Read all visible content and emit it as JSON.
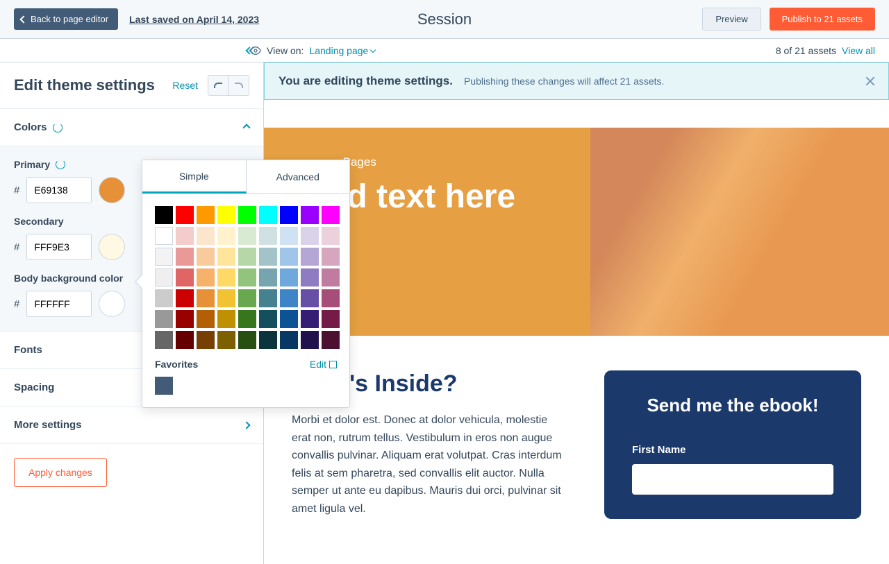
{
  "topbar": {
    "back": "Back to page editor",
    "last_saved": "Last saved on April 14, 2023",
    "title": "Session",
    "preview": "Preview",
    "publish": "Publish to 21 assets"
  },
  "subbar": {
    "view_on_label": "View on:",
    "view_on_value": "Landing page",
    "assets": "8 of 21 assets",
    "view_all": "View all"
  },
  "sidebar": {
    "title": "Edit theme settings",
    "reset": "Reset",
    "apply": "Apply changes",
    "sections": {
      "colors": "Colors",
      "fonts": "Fonts",
      "spacing": "Spacing",
      "more": "More settings"
    },
    "colors": {
      "primary": {
        "label": "Primary",
        "value": "E69138",
        "swatch": "#E69138"
      },
      "secondary": {
        "label": "Secondary",
        "value": "FFF9E3",
        "swatch": "#FFF9E3"
      },
      "body_bg": {
        "label": "Body background color",
        "value": "FFFFFF",
        "swatch": "#FFFFFF"
      }
    }
  },
  "notice": {
    "bold": "You are editing theme settings.",
    "text": "Publishing these changes will affect 21 assets."
  },
  "picker": {
    "tabs": {
      "simple": "Simple",
      "advanced": "Advanced"
    },
    "favorites_label": "Favorites",
    "edit": "Edit",
    "favorite_color": "#425b76",
    "grid": [
      [
        "#000000",
        "#ff0000",
        "#ff9900",
        "#ffff00",
        "#00ff00",
        "#00ffff",
        "#0000ff",
        "#9900ff",
        "#ff00ff"
      ],
      [
        "#ffffff",
        "#f4cccc",
        "#fce5cd",
        "#fff2cc",
        "#d9ead3",
        "#d0e0e3",
        "#cfe2f3",
        "#d9d2e9",
        "#ead1dc"
      ],
      [
        "#f3f3f3",
        "#ea9999",
        "#f9cb9c",
        "#ffe599",
        "#b6d7a8",
        "#a2c4c9",
        "#9fc5e8",
        "#b4a7d6",
        "#d5a6bd"
      ],
      [
        "#efefef",
        "#e06666",
        "#f6b26b",
        "#ffd966",
        "#93c47d",
        "#76a5af",
        "#6fa8dc",
        "#8e7cc3",
        "#c27ba0"
      ],
      [
        "#cccccc",
        "#cc0000",
        "#e69138",
        "#f1c232",
        "#6aa84f",
        "#45818e",
        "#3d85c6",
        "#674ea7",
        "#a64d79"
      ],
      [
        "#999999",
        "#990000",
        "#b45f06",
        "#bf9000",
        "#38761d",
        "#134f5c",
        "#0b5394",
        "#351c75",
        "#741b47"
      ],
      [
        "#666666",
        "#660000",
        "#783f04",
        "#7f6000",
        "#274e13",
        "#0c343d",
        "#073763",
        "#20124d",
        "#4c1130"
      ]
    ]
  },
  "preview": {
    "hero_label": "ng Pages",
    "hero_title": "dd text here",
    "body_title": "What's Inside?",
    "body_text": "Morbi et dolor est. Donec at dolor vehicula, molestie erat non, rutrum tellus. Vestibulum in eros non augue convallis pulvinar. Aliquam erat volutpat. Cras interdum felis at sem pharetra, sed convallis elit auctor. Nulla semper ut ante eu dapibus. Mauris dui orci, pulvinar sit amet ligula vel.",
    "form_title": "Send me the ebook!",
    "form_label": "First Name"
  }
}
